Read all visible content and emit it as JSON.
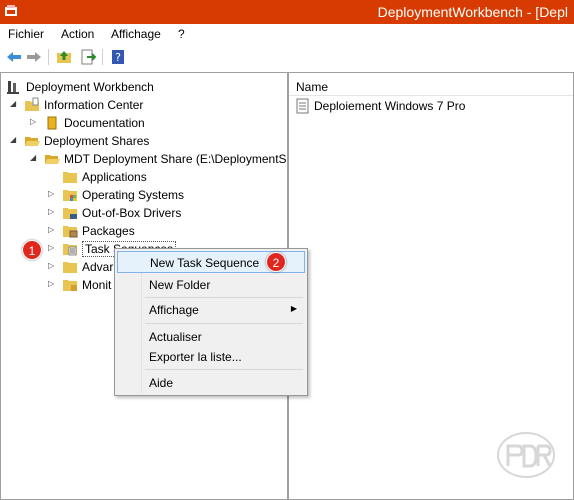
{
  "window": {
    "title": "DeploymentWorkbench - [Depl"
  },
  "menubar": {
    "items": [
      "Fichier",
      "Action",
      "Affichage",
      "?"
    ]
  },
  "tree": {
    "root": "Deployment Workbench",
    "information_center": "Information Center",
    "documentation": "Documentation",
    "deployment_shares": "Deployment Shares",
    "mdt_share": "MDT Deployment Share (E:\\DeploymentSl",
    "applications": "Applications",
    "operating_systems": "Operating Systems",
    "out_of_box_drivers": "Out-of-Box Drivers",
    "packages": "Packages",
    "task_sequences": "Task Sequences",
    "advanced": "Advar",
    "monitoring": "Monit"
  },
  "list": {
    "column_name": "Name",
    "items": [
      "Deploiement Windows 7 Pro"
    ]
  },
  "context_menu": {
    "new_task_sequence": "New Task Sequence",
    "new_folder": "New Folder",
    "affichage": "Affichage",
    "actualiser": "Actualiser",
    "exporter": "Exporter la liste...",
    "aide": "Aide"
  },
  "badges": {
    "step1": "1",
    "step2": "2"
  },
  "colors": {
    "titlebar": "#d83b01",
    "badge": "#e0261d",
    "hover": "#e5f1fb"
  }
}
